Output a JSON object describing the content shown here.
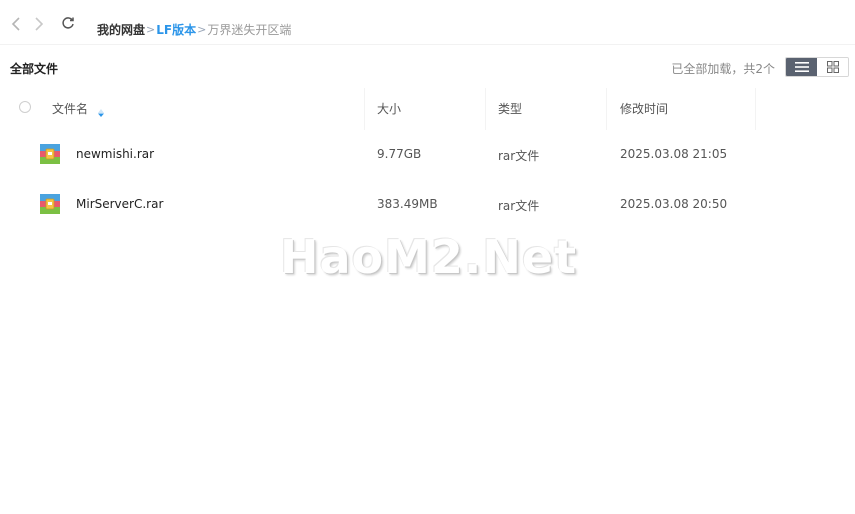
{
  "nav": {
    "breadcrumb": {
      "root": "我的网盘",
      "mid": "LF版本",
      "current": "万界迷失开区端",
      "separator": ">"
    }
  },
  "toolbar": {
    "all_files_label": "全部文件",
    "load_status": "已全部加载，共2个"
  },
  "table": {
    "headers": {
      "name": "文件名",
      "size": "大小",
      "type": "类型",
      "modified": "修改时间"
    },
    "rows": [
      {
        "name": "newmishi.rar",
        "size": "9.77GB",
        "type": "rar文件",
        "modified": "2025.03.08 21:05",
        "icon": "rar-archive-icon"
      },
      {
        "name": "MirServerC.rar",
        "size": "383.49MB",
        "type": "rar文件",
        "modified": "2025.03.08 20:50",
        "icon": "rar-archive-icon"
      }
    ]
  },
  "watermark": "HaoM2.Net",
  "colors": {
    "accent": "#2b95e9",
    "view_active": "#5a6270"
  }
}
